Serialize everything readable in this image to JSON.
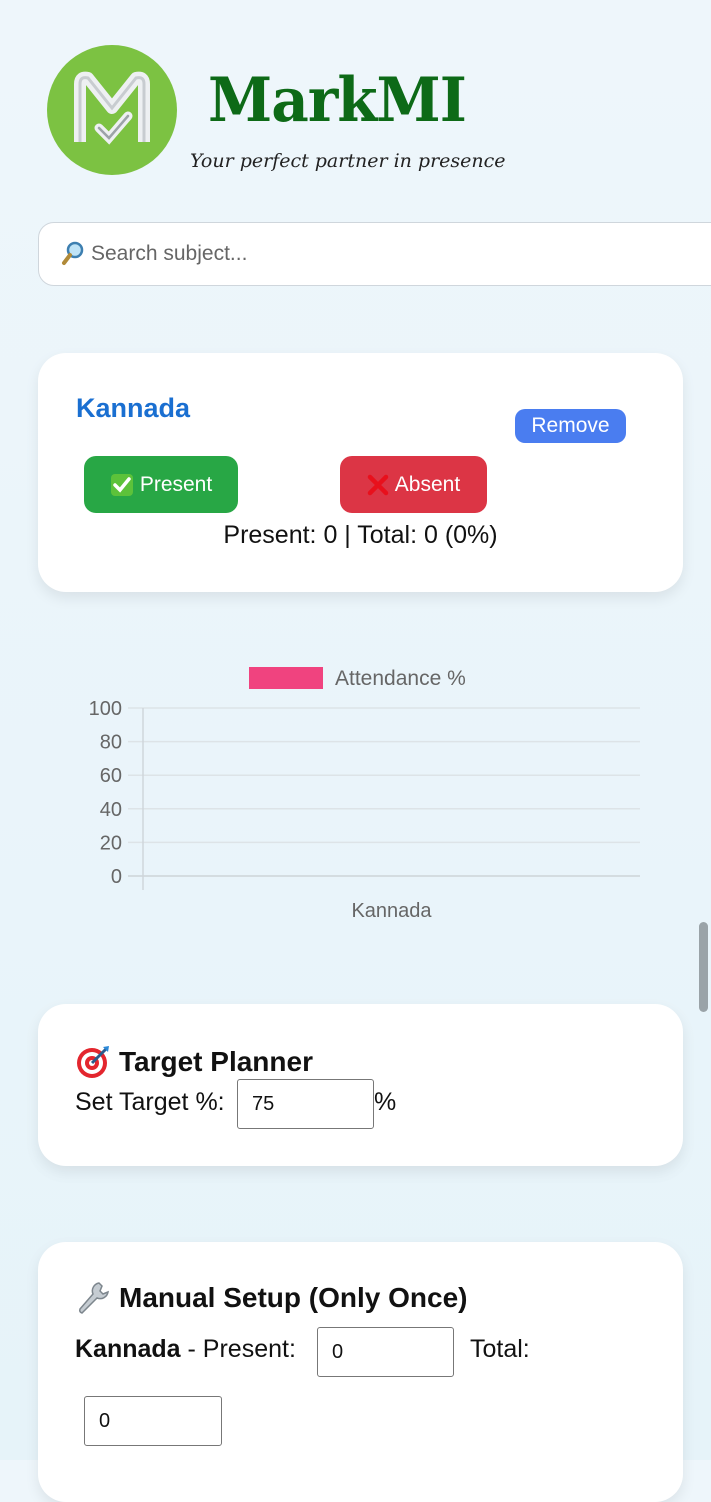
{
  "brand": {
    "name": "MarkMI",
    "tagline": "Your perfect partner in presence",
    "color": "#0d6a17",
    "logo_color": "#7cc242"
  },
  "search": {
    "placeholder": "Search subject...",
    "value": ""
  },
  "subject_card": {
    "title": "Kannada",
    "remove_label": "Remove",
    "present_label": "Present",
    "absent_label": "Absent",
    "stats": "Present: 0 | Total: 0 (0%)"
  },
  "chart_data": {
    "type": "bar",
    "categories": [
      "Kannada"
    ],
    "series": [
      {
        "name": "Attendance %",
        "values": [
          0
        ],
        "color": "#f0437f"
      }
    ],
    "ylim": [
      0,
      100
    ],
    "yticks": [
      "0",
      "20",
      "40",
      "60",
      "80",
      "100"
    ],
    "grid": true,
    "legend": "top-center"
  },
  "target_planner": {
    "title": "Target Planner",
    "label": "Set Target %:",
    "value": "75",
    "unit": "%"
  },
  "manual_setup": {
    "title": "Manual Setup (Only Once)",
    "subject": "Kannada",
    "present_label": " - Present:",
    "present_value": "0",
    "total_label": "Total:",
    "total_value": "0"
  }
}
